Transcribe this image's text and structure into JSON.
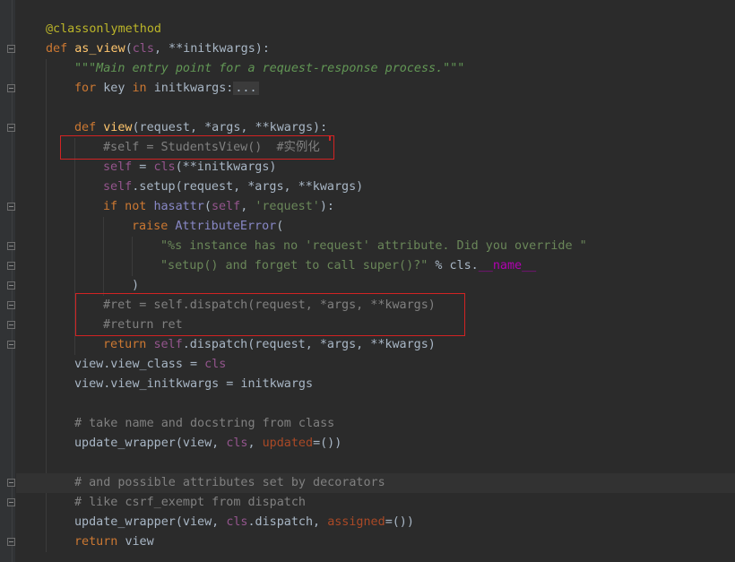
{
  "editor": {
    "lines": [
      {
        "tokens": [
          {
            "t": "@classonlymethod",
            "c": "dec"
          }
        ]
      },
      {
        "tokens": [
          {
            "t": "def ",
            "c": "kw"
          },
          {
            "t": "as_view",
            "c": "fn"
          },
          {
            "t": "(",
            "c": ""
          },
          {
            "t": "cls",
            "c": "cls"
          },
          {
            "t": ", **initkwargs):",
            "c": ""
          }
        ]
      },
      {
        "tokens": [
          {
            "t": "\"\"\"Main entry point for a request-response process.\"\"\"",
            "c": "doc"
          }
        ]
      },
      {
        "tokens": [
          {
            "t": "for ",
            "c": "kw"
          },
          {
            "t": "key ",
            "c": ""
          },
          {
            "t": "in ",
            "c": "kw"
          },
          {
            "t": "initkwargs:",
            "c": ""
          },
          {
            "t": "...",
            "c": "fold-inline"
          }
        ]
      },
      {
        "tokens": []
      },
      {
        "tokens": [
          {
            "t": "def ",
            "c": "kw"
          },
          {
            "t": "view",
            "c": "fn"
          },
          {
            "t": "(request, *args, **kwargs):",
            "c": ""
          }
        ]
      },
      {
        "tokens": [
          {
            "t": "#self = StudentsView()  #实例化",
            "c": "com"
          }
        ]
      },
      {
        "tokens": [
          {
            "t": "self",
            "c": "self"
          },
          {
            "t": " = ",
            "c": ""
          },
          {
            "t": "cls",
            "c": "cls"
          },
          {
            "t": "(**initkwargs)",
            "c": ""
          }
        ]
      },
      {
        "tokens": [
          {
            "t": "self",
            "c": "self"
          },
          {
            "t": ".setup(request, *args, **kwargs)",
            "c": ""
          }
        ]
      },
      {
        "tokens": [
          {
            "t": "if not ",
            "c": "kw"
          },
          {
            "t": "hasattr",
            "c": "builtin"
          },
          {
            "t": "(",
            "c": ""
          },
          {
            "t": "self",
            "c": "self"
          },
          {
            "t": ", ",
            "c": ""
          },
          {
            "t": "'request'",
            "c": "str"
          },
          {
            "t": "):",
            "c": ""
          }
        ]
      },
      {
        "tokens": [
          {
            "t": "raise ",
            "c": "kw"
          },
          {
            "t": "AttributeError",
            "c": "builtin"
          },
          {
            "t": "(",
            "c": ""
          }
        ]
      },
      {
        "tokens": [
          {
            "t": "\"%s instance has no 'request' attribute. Did you override \"",
            "c": "str"
          }
        ]
      },
      {
        "tokens": [
          {
            "t": "\"setup() and forget to call super()?\"",
            "c": "str"
          },
          {
            "t": " % cls.",
            "c": ""
          },
          {
            "t": "__name__",
            "c": "dunder"
          }
        ]
      },
      {
        "tokens": [
          {
            "t": ")",
            "c": ""
          }
        ]
      },
      {
        "tokens": [
          {
            "t": "#ret = self.dispatch(request, *args, **kwargs)",
            "c": "com"
          }
        ]
      },
      {
        "tokens": [
          {
            "t": "#return ret",
            "c": "com"
          }
        ]
      },
      {
        "tokens": [
          {
            "t": "return ",
            "c": "kw"
          },
          {
            "t": "self",
            "c": "self"
          },
          {
            "t": ".dispatch(request, *args, **kwargs)",
            "c": ""
          }
        ]
      },
      {
        "tokens": [
          {
            "t": "view.view_class = ",
            "c": ""
          },
          {
            "t": "cls",
            "c": "cls"
          }
        ]
      },
      {
        "tokens": [
          {
            "t": "view.view_initkwargs = initkwargs",
            "c": ""
          }
        ]
      },
      {
        "tokens": []
      },
      {
        "tokens": [
          {
            "t": "# take name and docstring from class",
            "c": "com"
          }
        ]
      },
      {
        "tokens": [
          {
            "t": "update_wrapper(view, ",
            "c": ""
          },
          {
            "t": "cls",
            "c": "cls"
          },
          {
            "t": ", ",
            "c": ""
          },
          {
            "t": "updated",
            "c": "param-kw"
          },
          {
            "t": "=())",
            "c": ""
          }
        ]
      },
      {
        "tokens": []
      },
      {
        "tokens": [
          {
            "t": "# and possible attributes set by decorators",
            "c": "com"
          }
        ]
      },
      {
        "tokens": [
          {
            "t": "# like csrf_exempt from dispatch",
            "c": "com"
          }
        ]
      },
      {
        "tokens": [
          {
            "t": "update_wrapper(view, ",
            "c": ""
          },
          {
            "t": "cls",
            "c": "cls"
          },
          {
            "t": ".dispatch, ",
            "c": ""
          },
          {
            "t": "assigned",
            "c": "param-kw"
          },
          {
            "t": "=())",
            "c": ""
          }
        ]
      },
      {
        "tokens": [
          {
            "t": "return ",
            "c": "kw"
          },
          {
            "t": "view",
            "c": ""
          }
        ]
      }
    ]
  },
  "colors": {
    "background": "#2b2b2b",
    "highlight_box": "#d22323"
  }
}
